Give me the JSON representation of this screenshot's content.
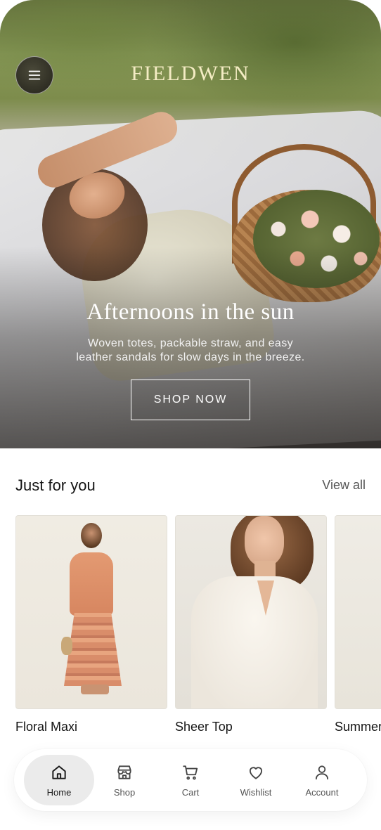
{
  "app": {
    "brand": "FIELDWEN"
  },
  "hero": {
    "headline": "Afternoons in the sun",
    "subtext_line1": "Woven totes, packable straw, and easy",
    "subtext_line2": "leather sandals for slow days in the breeze.",
    "cta": "SHOP NOW"
  },
  "section": {
    "title": "Just for you",
    "view_all": "View all"
  },
  "products": [
    {
      "name": "Floral Maxi"
    },
    {
      "name": "Sheer Top"
    },
    {
      "name": "Summer"
    }
  ],
  "tabs": [
    {
      "label": "Home",
      "icon": "home-icon",
      "active": true
    },
    {
      "label": "Shop",
      "icon": "store-icon",
      "active": false
    },
    {
      "label": "Cart",
      "icon": "cart-icon",
      "active": false
    },
    {
      "label": "Wishlist",
      "icon": "heart-icon",
      "active": false
    },
    {
      "label": "Account",
      "icon": "user-icon",
      "active": false
    }
  ],
  "colors": {
    "brand_text": "#f4ecc4",
    "active_tab_bg": "#ebebeb"
  }
}
